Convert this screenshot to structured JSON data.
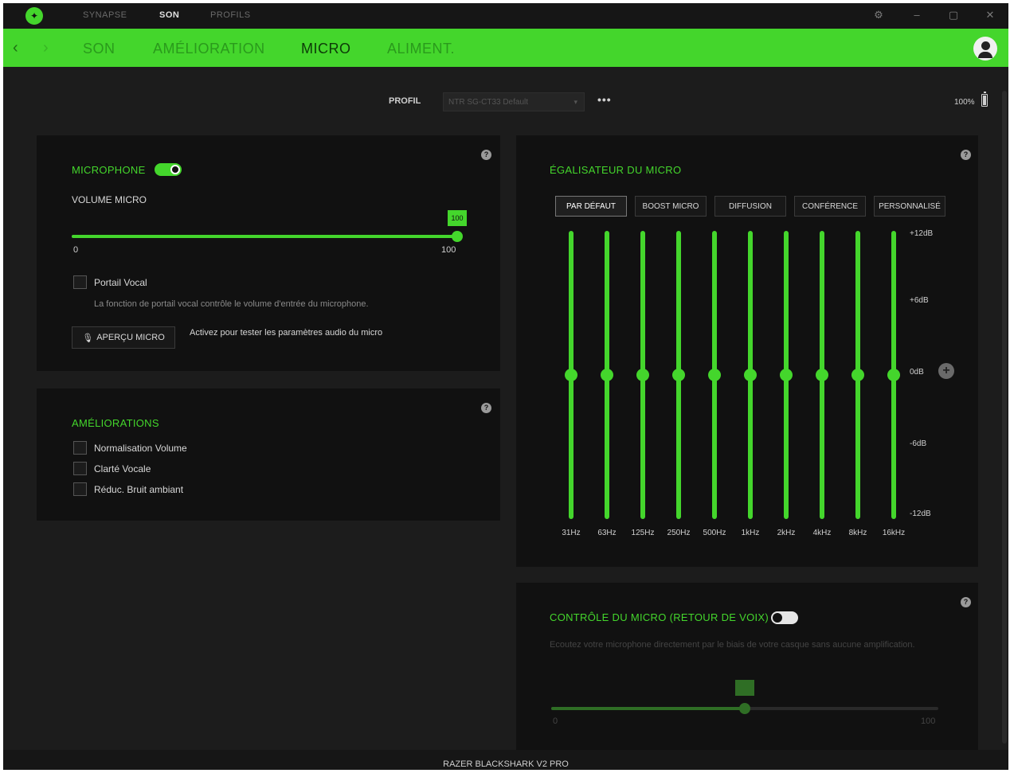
{
  "titlebar": {
    "tabs": [
      {
        "label": "SYNAPSE",
        "active": false
      },
      {
        "label": "SON",
        "active": true
      },
      {
        "label": "PROFILS",
        "active": false
      }
    ],
    "settings_icon": "gear-icon",
    "minimize_icon": "minimize-icon",
    "maximize_icon": "maximize-icon",
    "close_icon": "close-icon"
  },
  "nav": {
    "back_icon": "chevron-left-icon",
    "forward_icon": "chevron-right-icon",
    "tabs": [
      {
        "label": "SON",
        "active": false
      },
      {
        "label": "AMÉLIORATION",
        "active": false
      },
      {
        "label": "MICRO",
        "active": true
      },
      {
        "label": "ALIMENT.",
        "active": false
      }
    ],
    "avatar_icon": "user-avatar-icon"
  },
  "profile": {
    "label": "PROFIL",
    "selected": "NTR SG-CT33 Default",
    "more_label": "•••",
    "battery": "100%"
  },
  "microphone_panel": {
    "title": "MICROPHONE",
    "enabled": true,
    "volume_label": "VOLUME MICRO",
    "volume_value": "100",
    "volume_percent": 100,
    "min_label": "0",
    "max_label": "100",
    "voice_gate_label": "Portail Vocal",
    "voice_gate_desc": "La fonction de portail vocal contrôle le volume d'entrée du microphone.",
    "preview_button": "APERÇU MICRO",
    "preview_desc": "Activez pour tester les paramètres audio du micro"
  },
  "enhancements_panel": {
    "title": "AMÉLIORATIONS",
    "items": [
      {
        "label": "Normalisation Volume",
        "checked": false
      },
      {
        "label": "Clarté Vocale",
        "checked": false
      },
      {
        "label": "Réduc. Bruit ambiant",
        "checked": false
      }
    ]
  },
  "eq_panel": {
    "title": "ÉGALISATEUR DU MICRO",
    "presets": [
      {
        "label": "PAR DÉFAUT",
        "active": true
      },
      {
        "label": "BOOST MICRO",
        "active": false
      },
      {
        "label": "DIFFUSION",
        "active": false
      },
      {
        "label": "CONFÉRENCE",
        "active": false
      },
      {
        "label": "PERSONNALISÉ",
        "active": false
      }
    ],
    "db_labels": [
      "+12dB",
      "+6dB",
      "0dB",
      "-6dB",
      "-12dB"
    ],
    "bands": [
      {
        "freq": "31Hz",
        "gain_db": 0
      },
      {
        "freq": "63Hz",
        "gain_db": 0
      },
      {
        "freq": "125Hz",
        "gain_db": 0
      },
      {
        "freq": "250Hz",
        "gain_db": 0
      },
      {
        "freq": "500Hz",
        "gain_db": 0
      },
      {
        "freq": "1kHz",
        "gain_db": 0
      },
      {
        "freq": "2kHz",
        "gain_db": 0
      },
      {
        "freq": "4kHz",
        "gain_db": 0
      },
      {
        "freq": "8kHz",
        "gain_db": 0
      },
      {
        "freq": "16kHz",
        "gain_db": 0
      }
    ]
  },
  "sidetone_panel": {
    "title": "CONTRÔLE DU MICRO (RETOUR DE VOIX)",
    "enabled": false,
    "desc": "Ecoutez votre microphone directement par le biais de votre casque sans aucune amplification.",
    "value_percent": 50,
    "min_label": "0",
    "max_label": "100"
  },
  "footer": {
    "device_name": "RAZER BLACKSHARK V2 PRO"
  },
  "colors": {
    "accent": "#44d62c",
    "panel_bg": "#111111",
    "app_bg": "#1c1c1c"
  }
}
